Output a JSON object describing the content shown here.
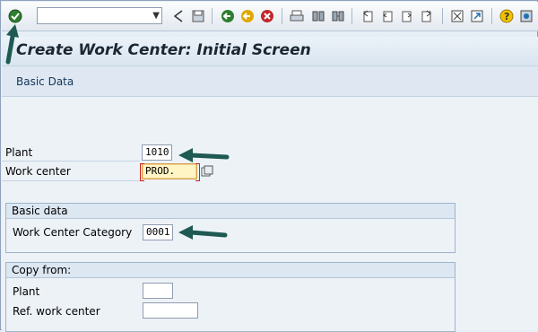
{
  "toolbar": {
    "command_value": "",
    "icons": [
      "enter-icon",
      "dropdown-icon",
      "back-nav-icon",
      "save-icon",
      "back-icon",
      "exit-icon",
      "cancel-icon",
      "print-icon",
      "find-icon",
      "find-next-icon",
      "first-page-icon",
      "previous-page-icon",
      "next-page-icon",
      "last-page-icon",
      "create-session-icon",
      "shortcut-icon",
      "help-icon",
      "customize-icon"
    ]
  },
  "title": "Create Work Center: Initial Screen",
  "appbar": {
    "basic_data": "Basic Data"
  },
  "fields": {
    "plant_label": "Plant",
    "plant_value": "1010",
    "work_center_label": "Work center",
    "work_center_value": "PROD."
  },
  "basic_group": {
    "title": "Basic data",
    "category_label": "Work Center Category",
    "category_value": "0001"
  },
  "copy_group": {
    "title": "Copy from:",
    "plant_label": "Plant",
    "plant_value": "",
    "ref_label": "Ref. work center",
    "ref_value": ""
  },
  "colors": {
    "arrow": "#1e5a52",
    "required_bg": "#fff5c4",
    "header_bg": "#dce7f2"
  }
}
